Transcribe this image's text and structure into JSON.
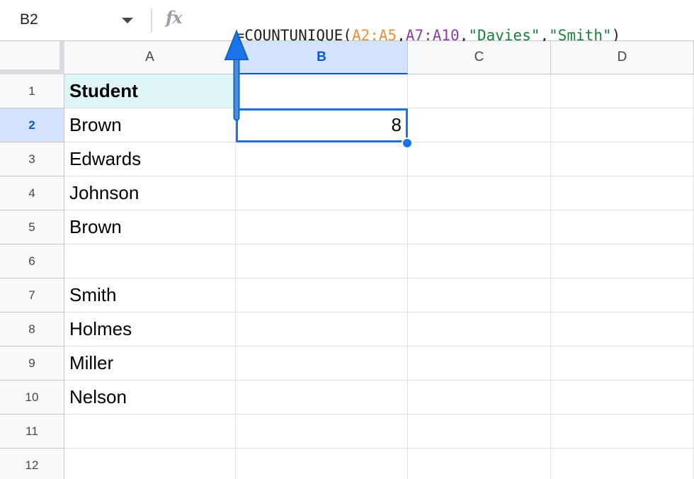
{
  "formula_bar": {
    "name_box": "B2",
    "fx_label": "fx",
    "formula_parts": [
      {
        "text": "=COUNTUNIQUE(",
        "color": "black"
      },
      {
        "text": "A2:A5",
        "color": "orange"
      },
      {
        "text": ",",
        "color": "black"
      },
      {
        "text": "A7:A10",
        "color": "purple"
      },
      {
        "text": ",",
        "color": "black"
      },
      {
        "text": "\"Davies\"",
        "color": "green"
      },
      {
        "text": ",",
        "color": "black"
      },
      {
        "text": "\"Smith\"",
        "color": "green"
      },
      {
        "text": ")",
        "color": "black"
      }
    ]
  },
  "columns": [
    "A",
    "B",
    "C",
    "D"
  ],
  "selected_column": "B",
  "selected_row": "2",
  "rows": [
    {
      "num": "1",
      "A": "Student",
      "B": ""
    },
    {
      "num": "2",
      "A": "Brown",
      "B": "8"
    },
    {
      "num": "3",
      "A": "Edwards",
      "B": ""
    },
    {
      "num": "4",
      "A": "Johnson",
      "B": ""
    },
    {
      "num": "5",
      "A": "Brown",
      "B": ""
    },
    {
      "num": "6",
      "A": "",
      "B": ""
    },
    {
      "num": "7",
      "A": "Smith",
      "B": ""
    },
    {
      "num": "8",
      "A": "Holmes",
      "B": ""
    },
    {
      "num": "9",
      "A": "Miller",
      "B": ""
    },
    {
      "num": "10",
      "A": "Nelson",
      "B": ""
    },
    {
      "num": "11",
      "A": "",
      "B": ""
    },
    {
      "num": "12",
      "A": "",
      "B": ""
    }
  ],
  "colors": {
    "selection": "#1a73e8",
    "header_cell_fill": "#dff6f8",
    "arrow": "#1a73e8"
  }
}
